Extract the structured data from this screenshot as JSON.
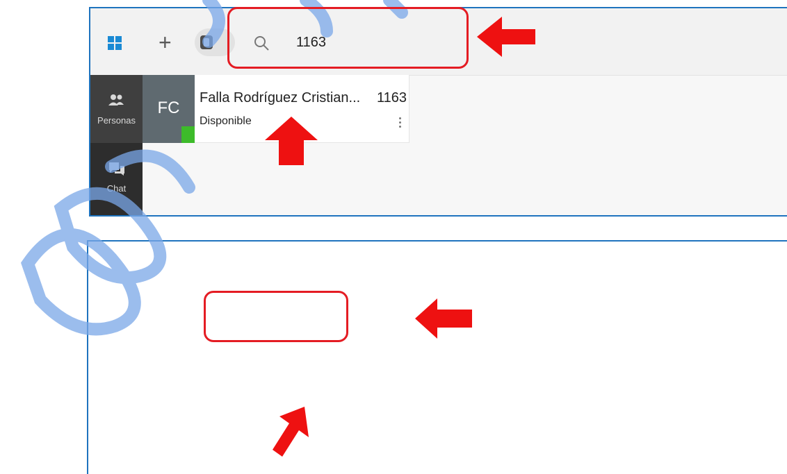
{
  "toolbar": {
    "windows_icon": "windows-logo-icon",
    "add_icon": "plus-icon",
    "add_label": "+",
    "contacts_icon": "contacts-icon",
    "search_icon": "search-icon",
    "search_value": "1163"
  },
  "sidebar": {
    "items": [
      {
        "label": "Personas",
        "icon": "people-icon",
        "active": true
      },
      {
        "label": "Chat",
        "icon": "chat-icon",
        "active": false
      }
    ]
  },
  "contact": {
    "initials": "FC",
    "name": "Falla Rodríguez Cristian...",
    "extension": "1163",
    "status": "Disponible",
    "status_color": "#3dbb2a",
    "avatar_color": "#5f6a70"
  },
  "annotations": {
    "highlight_color": "#e41c23",
    "frame_color": "#1e73be"
  }
}
